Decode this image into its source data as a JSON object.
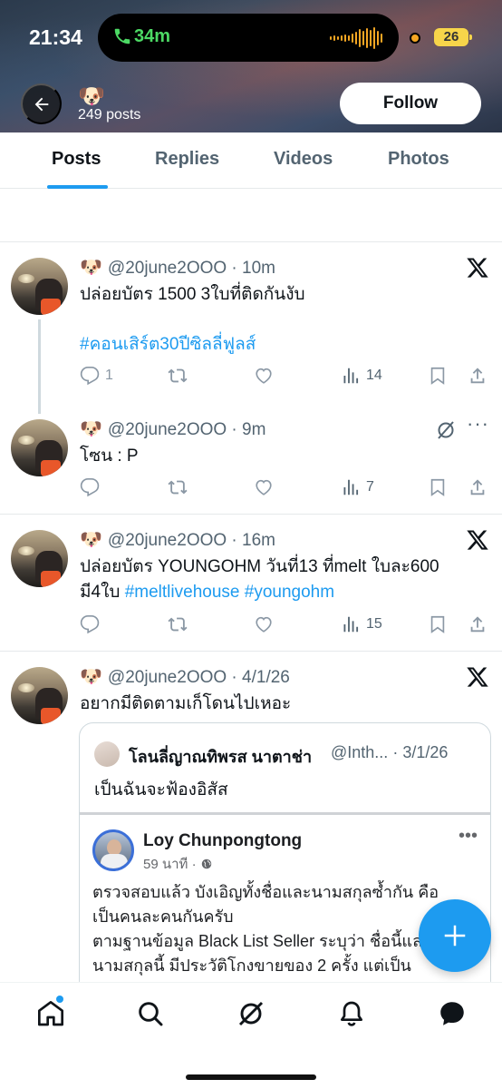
{
  "status_bar": {
    "time": "21:34",
    "call_duration": "34m",
    "battery": "26"
  },
  "header": {
    "avatar_emoji": "🐶",
    "post_count": "249 posts",
    "follow_label": "Follow"
  },
  "tabs": [
    {
      "label": "Posts",
      "active": true
    },
    {
      "label": "Replies",
      "active": false
    },
    {
      "label": "Videos",
      "active": false
    },
    {
      "label": "Photos",
      "active": false
    }
  ],
  "posts": [
    {
      "emoji": "🐶",
      "handle": "@20june2OOO",
      "time": "10m",
      "text_line1": "ปล่อยบัตร 1500 3ใบที่ติดกันงับ",
      "hashtag": "#คอนเสิร์ต30ปีซิลลี่ฟูลส์",
      "replies": "1",
      "views": "14"
    },
    {
      "emoji": "🐶",
      "handle": "@20june2OOO",
      "time": "9m",
      "text_line1": "โซน : P",
      "views": "7"
    },
    {
      "emoji": "🐶",
      "handle": "@20june2OOO",
      "time": "16m",
      "text_line1": "ปล่อยบัตร YOUNGOHM วันที่13 ที่melt ใบละ600",
      "text_line2_plain": "มี4ใบ",
      "hashtag1": "#meltlivehouse",
      "hashtag2": "#youngohm",
      "views": "15"
    },
    {
      "emoji": "🐶",
      "handle": "@20june2OOO",
      "time": "4/1/26",
      "text_line1": "อยากมีติดตามเก็โดนไปเหอะ",
      "quote": {
        "name": "โลนลี่ญาณทิพรส นาตาช่า",
        "handle": "@Inth...",
        "date": "3/1/26",
        "text": "เป็นฉันจะฟ้องอิสัส",
        "fb_name": "Loy Chunpongtong",
        "fb_time": "59 นาที ·",
        "fb_line1": "ตรวจสอบแล้ว บังเอิญทั้งชื่อและนามสกุลซ้ำกัน คือ",
        "fb_line2": "เป็นคนละคนกันครับ",
        "fb_line3": "ตามฐานข้อมูล Black List Seller ระบุว่า ชื่อนี้และ",
        "fb_line4": "นามสกุลนี้ มีประวัติโกงขายของ 2 ครั้ง แต่เป็น"
      }
    }
  ],
  "colors": {
    "accent": "#1d9bf0",
    "text": "#0f1419",
    "secondary": "#536471"
  }
}
